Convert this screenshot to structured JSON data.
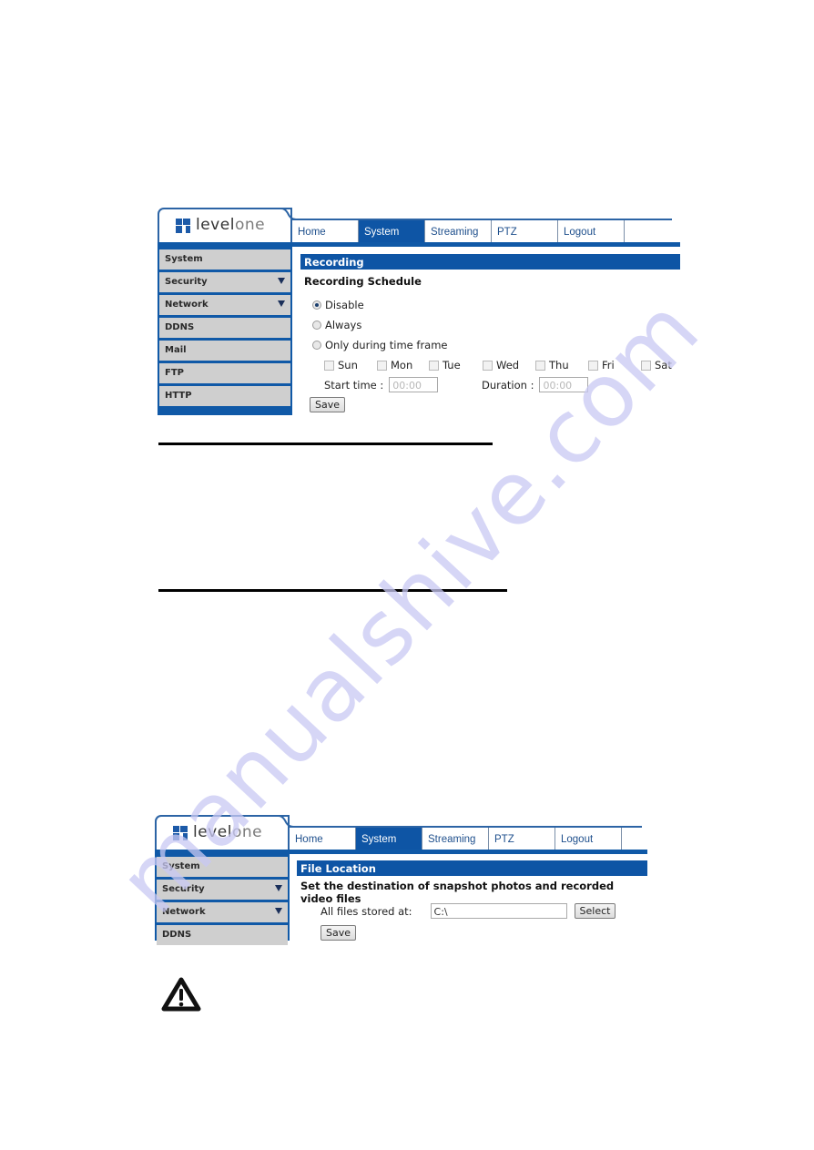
{
  "watermark": "manualshive.com",
  "screenshot1": {
    "logo": {
      "part1": "level",
      "part2": "one"
    },
    "nav": [
      {
        "label": "Home",
        "active": false
      },
      {
        "label": "System",
        "active": true
      },
      {
        "label": "Streaming",
        "active": false
      },
      {
        "label": "PTZ",
        "active": false
      },
      {
        "label": "Logout",
        "active": false
      }
    ],
    "sidebar": [
      {
        "label": "System",
        "has_submenu": false
      },
      {
        "label": "Security",
        "has_submenu": true
      },
      {
        "label": "Network",
        "has_submenu": true
      },
      {
        "label": "DDNS",
        "has_submenu": false
      },
      {
        "label": "Mail",
        "has_submenu": false
      },
      {
        "label": "FTP",
        "has_submenu": false
      },
      {
        "label": "HTTP",
        "has_submenu": false
      }
    ],
    "section_title": "Recording",
    "heading": "Recording Schedule",
    "options": [
      {
        "label": "Disable",
        "selected": true
      },
      {
        "label": "Always",
        "selected": false
      },
      {
        "label": "Only during time frame",
        "selected": false
      }
    ],
    "days": [
      {
        "label": "Sun",
        "checked": false
      },
      {
        "label": "Mon",
        "checked": false
      },
      {
        "label": "Tue",
        "checked": false
      },
      {
        "label": "Wed",
        "checked": false
      },
      {
        "label": "Thu",
        "checked": false
      },
      {
        "label": "Fri",
        "checked": false
      },
      {
        "label": "Sat",
        "checked": false
      }
    ],
    "start_time_label": "Start time :",
    "start_time_value": "00:00",
    "duration_label": "Duration :",
    "duration_value": "00:00",
    "save_label": "Save"
  },
  "screenshot2": {
    "logo": {
      "part1": "level",
      "part2": "one"
    },
    "nav": [
      {
        "label": "Home",
        "active": false
      },
      {
        "label": "System",
        "active": true
      },
      {
        "label": "Streaming",
        "active": false
      },
      {
        "label": "PTZ",
        "active": false
      },
      {
        "label": "Logout",
        "active": false
      }
    ],
    "sidebar": [
      {
        "label": "System",
        "has_submenu": false
      },
      {
        "label": "Security",
        "has_submenu": true
      },
      {
        "label": "Network",
        "has_submenu": true
      },
      {
        "label": "DDNS",
        "has_submenu": false
      }
    ],
    "section_title": "File Location",
    "heading": "Set the destination of snapshot photos and recorded video files",
    "files_label": "All files stored at:",
    "files_value": "C:\\",
    "select_label": "Select",
    "save_label": "Save"
  },
  "warning_icon": "warning-triangle-icon"
}
